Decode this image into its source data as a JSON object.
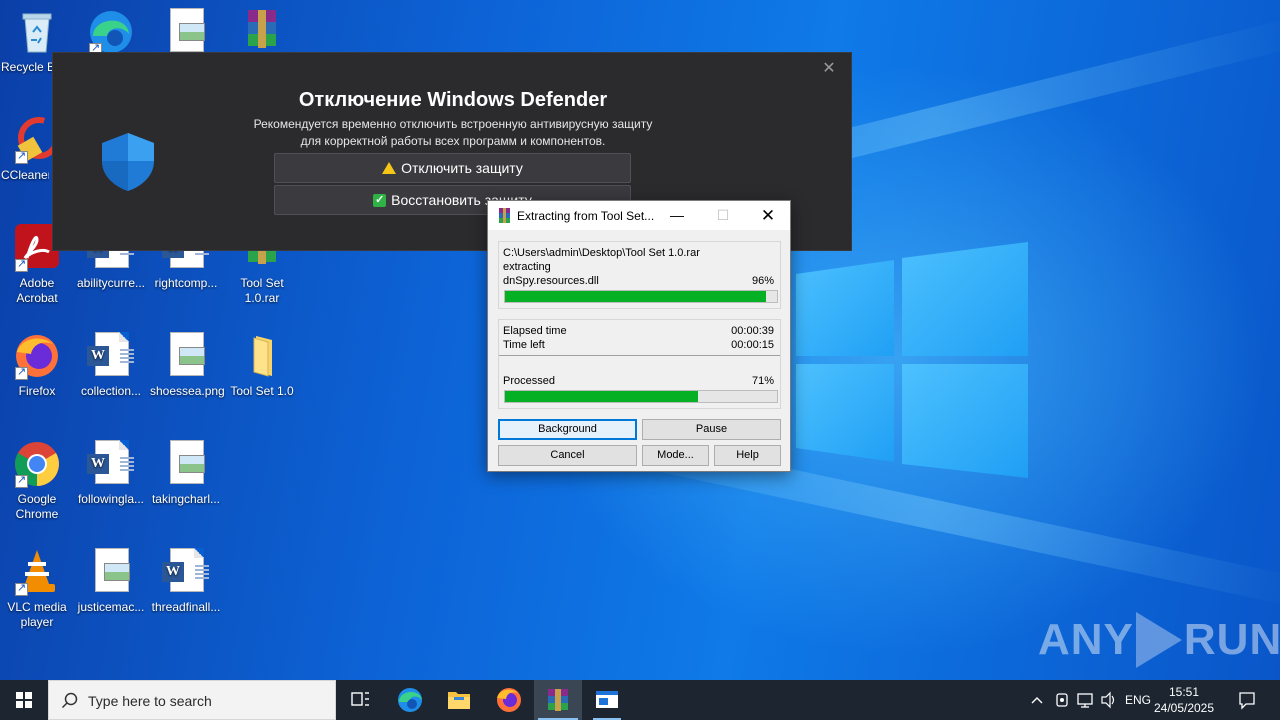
{
  "desktop_icons": [
    {
      "label": "Recycle Bin",
      "icon": "recycle-bin-icon"
    },
    {
      "label": "CCleaner",
      "icon": "ccleaner-icon"
    },
    {
      "label": "Adobe Acrobat",
      "icon": "acrobat-icon"
    },
    {
      "label": "abilitycurre...",
      "icon": "word-doc-icon"
    },
    {
      "label": "rightcomp...",
      "icon": "word-doc-icon"
    },
    {
      "label": "Tool Set 1.0.rar",
      "icon": "winrar-archive-icon"
    },
    {
      "label": "Firefox",
      "icon": "firefox-icon"
    },
    {
      "label": "collection...",
      "icon": "word-doc-icon"
    },
    {
      "label": "shoessea.png",
      "icon": "image-file-icon"
    },
    {
      "label": "Tool Set 1.0",
      "icon": "folder-icon"
    },
    {
      "label": "Google Chrome",
      "icon": "chrome-icon"
    },
    {
      "label": "followingla...",
      "icon": "word-doc-icon"
    },
    {
      "label": "takingcharl...",
      "icon": "image-file-icon"
    },
    {
      "label": "VLC media player",
      "icon": "vlc-icon"
    },
    {
      "label": "justicemac...",
      "icon": "image-file-icon"
    },
    {
      "label": "threadfinall...",
      "icon": "word-doc-icon"
    }
  ],
  "defender_overlay": {
    "title": "Отключение Windows Defender",
    "description": "Рекомендуется временно отключить встроенную антивирусную защиту для корректной работы всех программ и компонентов.",
    "disable_button": "Отключить защиту",
    "restore_button": "Восстановить защиту",
    "close_icon": "close-icon"
  },
  "rar_dialog": {
    "title": "Extracting from Tool Set...",
    "archive_path": "C:\\Users\\admin\\Desktop\\Tool Set 1.0.rar",
    "action": "extracting",
    "current_file": "dnSpy.resources.dll",
    "file_percent_label": "96%",
    "file_progress": 0.96,
    "elapsed_label": "Elapsed time",
    "elapsed_value": "00:00:39",
    "time_left_label": "Time left",
    "time_left_value": "00:00:15",
    "processed_label": "Processed",
    "processed_percent_label": "71%",
    "processed_progress": 0.71,
    "buttons": {
      "background": "Background",
      "pause": "Pause",
      "cancel": "Cancel",
      "mode": "Mode...",
      "help": "Help"
    }
  },
  "watermark": {
    "left": "ANY",
    "right": "RUN"
  },
  "taskbar": {
    "search_placeholder": "Type here to search",
    "language": "ENG",
    "time": "15:51",
    "date": "24/05/2025"
  },
  "colors": {
    "progress_green": "#06b025",
    "taskbar_bg": "#1c2530",
    "overlay_bg": "#2b2b2e"
  }
}
